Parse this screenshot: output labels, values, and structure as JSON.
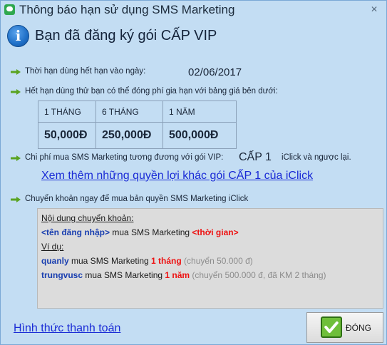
{
  "window": {
    "title": "Thông báo hạn sử dụng SMS Marketing",
    "close_glyph": "✕"
  },
  "header": {
    "info_glyph": "i",
    "text": "Bạn đã đăng ký gói CẤP VIP"
  },
  "expiry": {
    "label": "Thời hạn dùng hết hạn vào ngày:",
    "date": "02/06/2017"
  },
  "trial": {
    "label": "Hết hạn dùng thử bạn có thể đóng phí gia hạn với bảng giá bên dưới:"
  },
  "price_table": {
    "headers": [
      "1 THÁNG",
      "6 THÁNG",
      "1 NĂM"
    ],
    "values": [
      "50,000Đ",
      "250,000Đ",
      "500,000Đ"
    ]
  },
  "vip_cost": {
    "label": "Chi phí mua SMS Marketing tương đương với gói VIP:",
    "value": "CẤP 1",
    "suffix": "iClick và ngược lại."
  },
  "more_link": "Xem thêm những quyền lợi khác gói CẤP 1 của iClick",
  "transfer": {
    "label": "Chuyển khoản ngay để mua bản quyền SMS Marketing iClick",
    "box": {
      "heading": "Nội dung chuyển khoản:",
      "template_user": "<tên đăng nhập>",
      "template_mid": " mua SMS Marketing ",
      "template_time": "<thời gian>",
      "example_heading": "Ví dụ:",
      "ex1_user": "quanly",
      "ex1_mid": " mua SMS Marketing ",
      "ex1_time": "1 tháng",
      "ex1_note": "  (chuyển 50.000 đ)",
      "ex2_user": "trungvusc",
      "ex2_mid": " mua SMS Marketing ",
      "ex2_time": "1 năm",
      "ex2_note": "  (chuyển 500.000 đ, đã KM 2 tháng)"
    }
  },
  "footer": {
    "payment_link": "Hình thức thanh toán",
    "close_button": "ĐÓNG"
  },
  "icons": {
    "app": "sms-app-icon",
    "info": "info-icon",
    "bullet": "green-arrow-icon",
    "check": "checkmark-icon"
  },
  "colors": {
    "window_bg": "#c3ddf3",
    "link": "#1a2bd6",
    "highlight_blue": "#1a3fb0",
    "highlight_red": "#ee1111",
    "bullet_green": "#5aa321"
  }
}
